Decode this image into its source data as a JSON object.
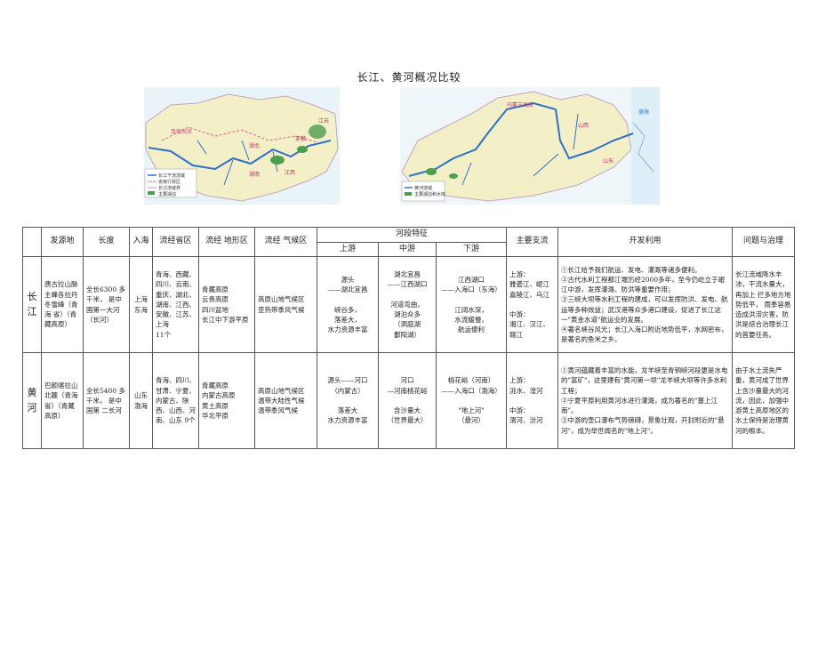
{
  "title": "长江、黄河概况比较",
  "maps": {
    "yangtze": {
      "labels": [
        "青藏高原",
        "湖北",
        "湖南",
        "江西",
        "安徽",
        "江苏"
      ],
      "legend": [
        "长江干流流域",
        "省级行政区",
        "长江流域界",
        "主要湖泊"
      ]
    },
    "yellow": {
      "labels": [
        "内蒙古高原",
        "山西",
        "山东",
        "渤海"
      ],
      "legend": [
        "黄河流域",
        "主要湖泊和水库"
      ]
    }
  },
  "table": {
    "headers": {
      "blank": "",
      "source": "发源地",
      "length": "长度",
      "mouth": "入海",
      "provinces": "流经省区",
      "terrain": "流经 地形区",
      "climate": "流经 气候区",
      "sections": "河段特征",
      "upper": "上游",
      "middle": "中游",
      "lower": "下游",
      "tributaries": "主要支流",
      "development": "开发利用",
      "issues": "问题与治理"
    },
    "rows": [
      {
        "river": "长江",
        "source": "唐古拉山脉主峰各拉丹冬雪峰（青海 省）（青 藏高原）",
        "length": "全长6300 多千米， 是中国第一大河（长河）",
        "mouth": "上海\n东海",
        "provinces": "青海、西藏、四川、云南、重庆、湖北、湖南、江西、安徽、江苏、上海\n11个",
        "terrain": "青藏高原\n云贵高原\n四川盆地\n长江中下游平原",
        "climate": "高原山地气候区\n亚热带季风气候",
        "upper": "源头\n——湖北宜昌\n\n峡谷多，\n落差大，\n水力资源丰富",
        "middle": "湖北宜昌\n——江西湖口\n\n河道弯曲，\n湖泊众多\n（洞庭湖\n鄱阳湖）",
        "lower": "江西湖口\n——入海口（东海）\n\n江阔水深，\n水流缓慢，\n航运便利",
        "tributaries": "上游：\n雅砻江、岷江\n嘉陵江、乌江\n\n中游：\n湘江、汉江、\n赣江",
        "development": "①长江给予我们航运、发电、灌溉等诸多便利。\n②古代水利工程都江堰历经2000多年，至今仍屹立于岷江中游，发挥灌溉、防洪等重要作用；\n③三峡大坝等水利工程的建成，可以发挥防洪、发电、航运等多种效益；武汉港等众多港口建设，促进了长江这一\"黄金水道\"航运业的发展。\n④著名峡谷风光；长江入海口附近地势低平，水网密布，是著名的鱼米之乡。",
        "issues": "长江流域降水丰沛，干流水量大，再加上 拦多地方地势低平， 雨季容易造成洪涝灾害，防洪是综合治理长江的首要任务。"
      },
      {
        "river": "黄河",
        "source": "巴颜喀拉山北麓（青海省）（青藏高原）",
        "length": "全长5400 多千米， 是中国第 二长河",
        "mouth": "山东\n渤海",
        "provinces": "青海、四川、甘肃、宁夏、内蒙古、陕西、山西、河南、山东 9个",
        "terrain": "青藏高原\n内蒙古高原\n黄土高原\n华北平原",
        "climate": "高原山地气候区\n温带大陆性气候\n温带季风气候",
        "upper": "源头——河口\n（内蒙古）\n\n落差大\n水力资源丰富",
        "middle": "河口\n—河南桃花峪\n\n含沙量大\n（世界最大）",
        "lower": "桃花峪（河南）\n——入海口（渤海）\n\n\"地上河\"\n（悬河）",
        "tributaries": "上游：\n洮水、湟河\n\n中游：\n渭河、汾河",
        "development": "①黄河蕴藏着丰富的水能，龙羊峡至青铜峡河段更是水电的\"富矿\"，这里建有\"黄河第一坝\"龙羊峡大坝等许多水利工程；\n②宁夏平原利用黄河水进行灌溉，成为著名的\"塞上江南\"。\n③中游的壶口瀑布气势磅礴，景象壮观，开封附近的\"悬河\"，成为举世闻名的\"地上河\"。",
        "issues": "由于水土流失严重，黄河成了世界上含沙量最大的河流，因此，加强中游黄土高原地区的水土保持是治理黄河的根本。"
      }
    ]
  },
  "colors": {
    "yangtze_river": "#2f6fd0",
    "yellow_river": "#2f6fd0",
    "province_red": "#e25a8a",
    "land_fill": "#f3f0c8",
    "sea": "#dfeff8"
  }
}
